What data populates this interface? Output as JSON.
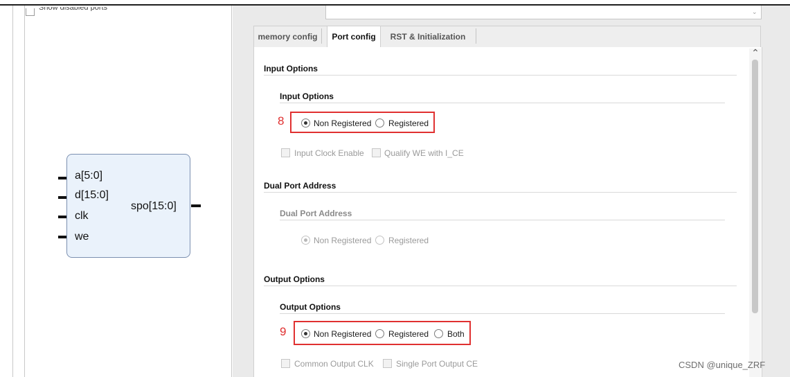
{
  "top": {
    "partial_check_label": "Show disabled ports"
  },
  "symbol": {
    "inputs": [
      "a[5:0]",
      "d[15:0]",
      "clk",
      "we"
    ],
    "output": "spo[15:0]"
  },
  "tabs": [
    "memory config",
    "Port config",
    "RST & Initialization"
  ],
  "active_tab": "Port config",
  "input_options": {
    "section_title": "Input Options",
    "group_title": "Input Options",
    "step_number": "8",
    "radios": [
      {
        "label": "Non Registered",
        "selected": true
      },
      {
        "label": "Registered",
        "selected": false
      }
    ],
    "checkboxes": [
      {
        "label": "Input Clock Enable",
        "checked": false,
        "enabled": false
      },
      {
        "label": "Qualify WE with I_CE",
        "checked": false,
        "enabled": false
      }
    ]
  },
  "dual_port_address": {
    "section_title": "Dual Port Address",
    "group_title": "Dual Port Address",
    "radios": [
      {
        "label": "Non Registered",
        "selected": true,
        "enabled": false
      },
      {
        "label": "Registered",
        "selected": false,
        "enabled": false
      }
    ]
  },
  "output_options": {
    "section_title": "Output Options",
    "group_title": "Output Options",
    "step_number": "9",
    "radios": [
      {
        "label": "Non Registered",
        "selected": true
      },
      {
        "label": "Registered",
        "selected": false
      },
      {
        "label": "Both",
        "selected": false
      }
    ],
    "checkboxes": [
      {
        "label": "Common Output CLK",
        "checked": false,
        "enabled": false
      },
      {
        "label": "Single Port Output CE",
        "checked": false,
        "enabled": false
      }
    ]
  },
  "watermark": "CSDN @unique_ZRF",
  "colors": {
    "highlight_box": "#e03030",
    "symbol_fill": "#eaf2fb",
    "symbol_border": "#7b8fb0"
  },
  "icons": {
    "scroll_up": "chevron-up-icon"
  }
}
